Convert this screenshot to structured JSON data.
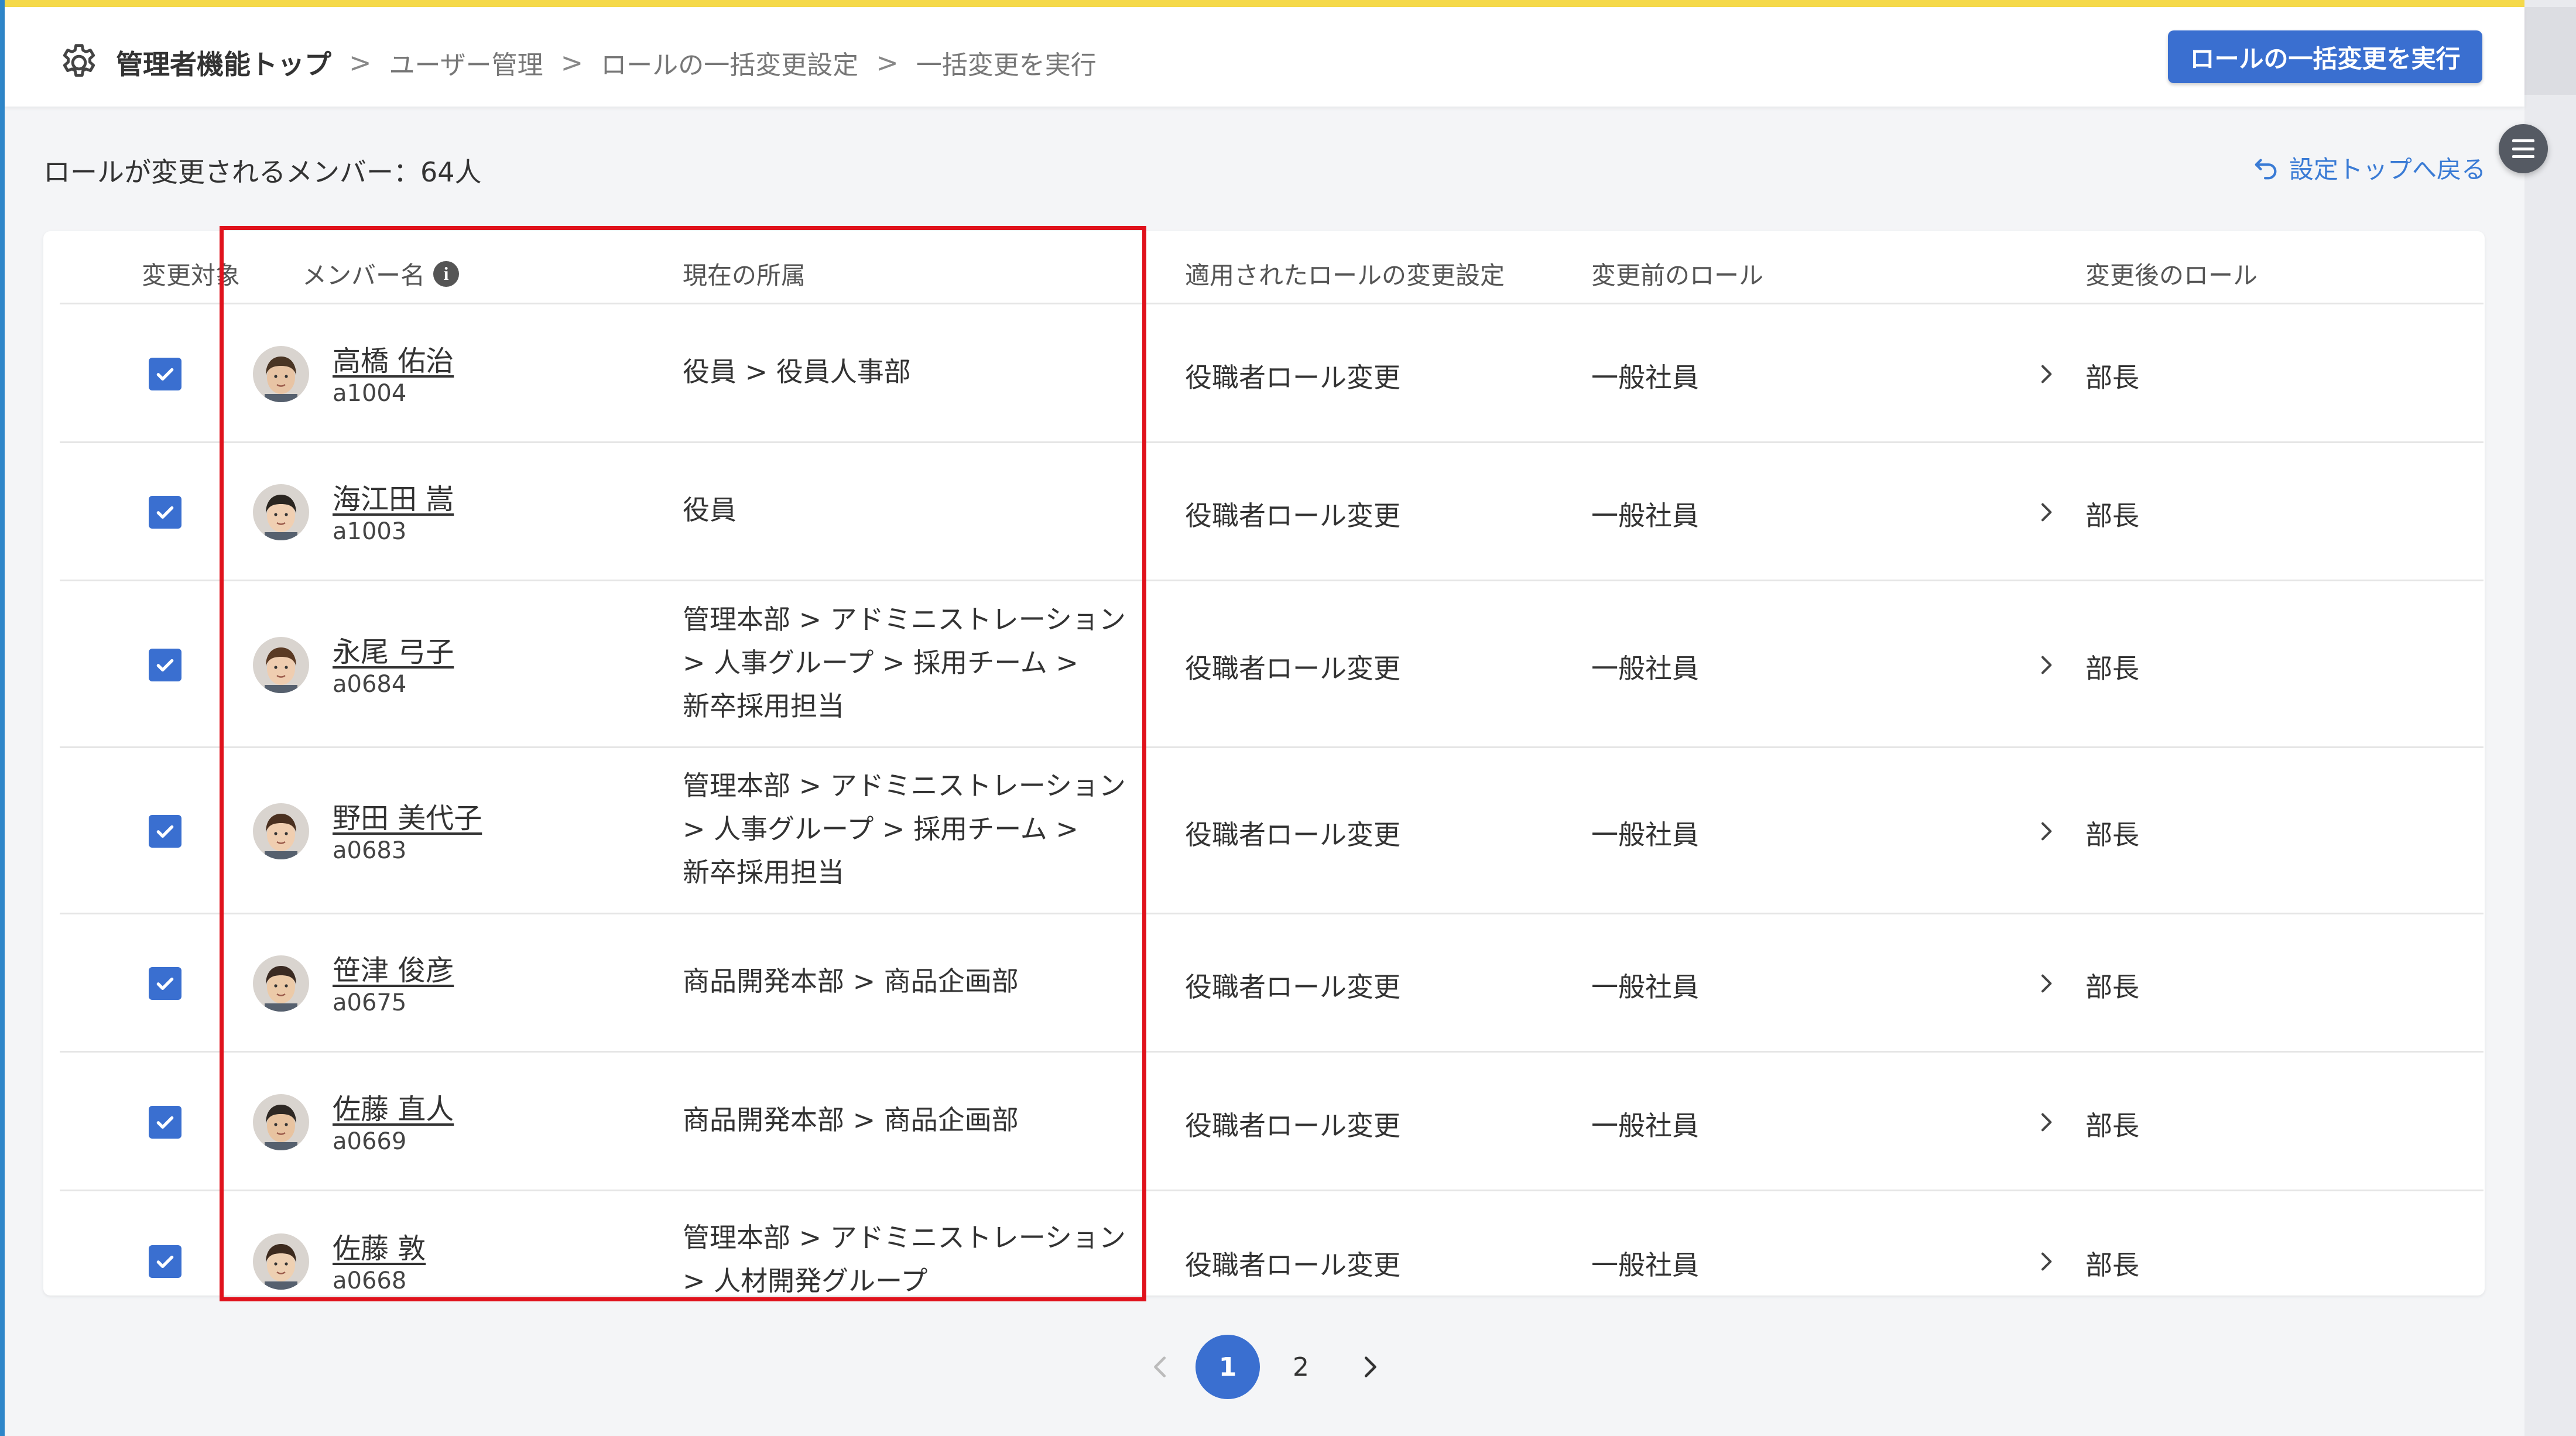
{
  "header": {
    "breadcrumb": [
      "管理者機能トップ",
      "ユーザー管理",
      "ロールの一括変更設定",
      "一括変更を実行"
    ],
    "execute_button": "ロールの一括変更を実行"
  },
  "summary": {
    "member_count_text": "ロールが変更されるメンバー：64人",
    "back_link": "設定トップへ戻る"
  },
  "table": {
    "columns": [
      "変更対象",
      "メンバー名",
      "現在の所属",
      "適用されたロールの変更設定",
      "変更前のロール",
      "変更後のロール"
    ],
    "rows": [
      {
        "checked": true,
        "name": "高橋 佑治",
        "id": "a1004",
        "dept": "役員 > 役員人事部",
        "setting": "役職者ロール変更",
        "before": "一般社員",
        "after": "部長"
      },
      {
        "checked": true,
        "name": "海江田 嵩",
        "id": "a1003",
        "dept": "役員",
        "setting": "役職者ロール変更",
        "before": "一般社員",
        "after": "部長"
      },
      {
        "checked": true,
        "name": "永尾 弓子",
        "id": "a0684",
        "dept": "管理本部 > アドミニストレーション > 人事グループ > 採用チーム > 新卒採用担当",
        "setting": "役職者ロール変更",
        "before": "一般社員",
        "after": "部長"
      },
      {
        "checked": true,
        "name": "野田 美代子",
        "id": "a0683",
        "dept": "管理本部 > アドミニストレーション > 人事グループ > 採用チーム > 新卒採用担当",
        "setting": "役職者ロール変更",
        "before": "一般社員",
        "after": "部長"
      },
      {
        "checked": true,
        "name": "笹津 俊彦",
        "id": "a0675",
        "dept": "商品開発本部 > 商品企画部",
        "setting": "役職者ロール変更",
        "before": "一般社員",
        "after": "部長"
      },
      {
        "checked": true,
        "name": "佐藤 直人",
        "id": "a0669",
        "dept": "商品開発本部 > 商品企画部",
        "setting": "役職者ロール変更",
        "before": "一般社員",
        "after": "部長"
      },
      {
        "checked": true,
        "name": "佐藤 敦",
        "id": "a0668",
        "dept": "管理本部 > アドミニストレーション > 人材開発グループ",
        "setting": "役職者ロール変更",
        "before": "一般社員",
        "after": "部長"
      }
    ]
  },
  "pagination": {
    "current": "1",
    "next_page": "2"
  },
  "colors": {
    "accent": "#3a6fd0",
    "highlight": "#e0121c",
    "top_stripe": "#f5d94a",
    "link": "#3a7bd5"
  }
}
